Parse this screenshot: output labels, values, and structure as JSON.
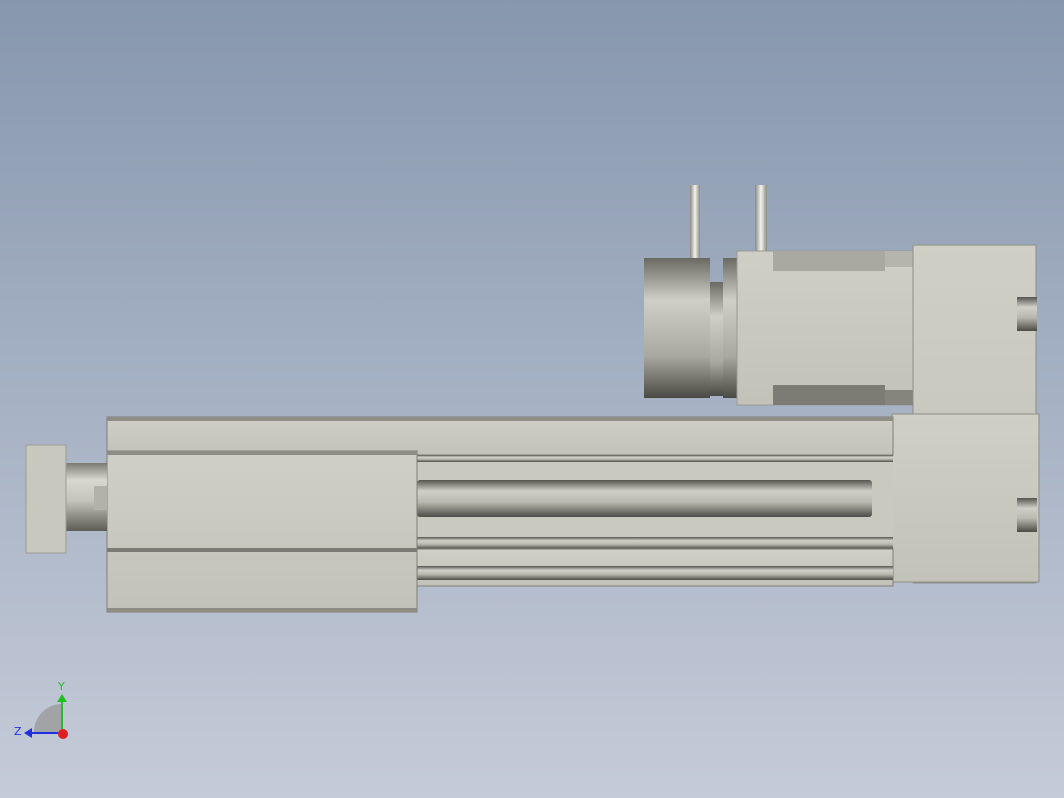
{
  "viewport": {
    "background_top": "#8797ad",
    "background_bottom": "#c5cbd8"
  },
  "model": {
    "body_color": "#c6c6bc",
    "shadow_color": "#6f6f68",
    "highlight_color": "#e4e4de"
  },
  "triad": {
    "x_axis_color": "#e02020",
    "y_axis_color": "#20c020",
    "z_axis_color": "#2030e0",
    "y_label": "Y",
    "z_label": "Z"
  }
}
